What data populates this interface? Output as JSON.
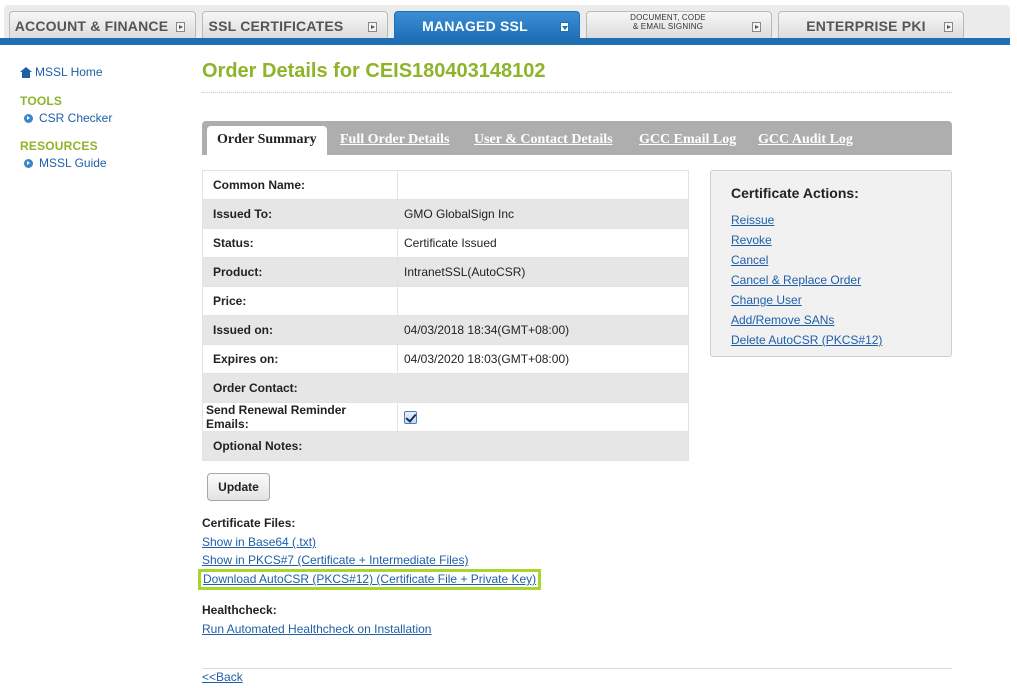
{
  "top_tabs": [
    {
      "label": "ACCOUNT & FINANCE"
    },
    {
      "label": "SSL CERTIFICATES"
    },
    {
      "label": "MANAGED SSL"
    },
    {
      "label_line1": "DOCUMENT, CODE",
      "label_line2": "& EMAIL SIGNING"
    },
    {
      "label": "ENTERPRISE PKI"
    }
  ],
  "sidebar": {
    "home": "MSSL Home",
    "tools_heading": "TOOLS",
    "tools": [
      "CSR Checker"
    ],
    "resources_heading": "RESOURCES",
    "resources": [
      "MSSL Guide"
    ]
  },
  "page_title": "Order Details for CEIS180403148102",
  "sub_tabs": [
    "Order Summary",
    "Full Order Details",
    "User & Contact Details",
    "GCC Email Log",
    "GCC Audit Log"
  ],
  "details": [
    {
      "label": "Common Name:",
      "value": ""
    },
    {
      "label": "Issued To:",
      "value": "GMO GlobalSign Inc"
    },
    {
      "label": "Status:",
      "value": "Certificate Issued"
    },
    {
      "label": "Product:",
      "value": "IntranetSSL(AutoCSR)"
    },
    {
      "label": "Price:",
      "value": ""
    },
    {
      "label": "Issued on:",
      "value": "04/03/2018 18:34(GMT+08:00)"
    },
    {
      "label": "Expires on:",
      "value": "04/03/2020 18:03(GMT+08:00)"
    },
    {
      "label": "Order Contact:",
      "value": ""
    },
    {
      "label": "Send Renewal Reminder Emails:",
      "checked": true
    },
    {
      "label": "Optional Notes:",
      "value": ""
    }
  ],
  "update_button": "Update",
  "actions": {
    "title": "Certificate Actions:",
    "links": [
      "Reissue",
      "Revoke",
      "Cancel",
      "Cancel & Replace Order",
      "Change User",
      "Add/Remove SANs",
      "Delete AutoCSR (PKCS#12)"
    ]
  },
  "certificate_files": {
    "heading": "Certificate Files:",
    "links": [
      "Show in Base64 (.txt)",
      "Show in PKCS#7 (Certificate + Intermediate Files)",
      "Download AutoCSR (PKCS#12) (Certificate File + Private Key)"
    ]
  },
  "healthcheck": {
    "heading": "Healthcheck:",
    "link": "Run Automated Healthcheck on Installation"
  },
  "back_link": "<<Back",
  "colors": {
    "brand_blue": "#1f6fb5",
    "heading_green": "#8db42a",
    "link_blue": "#1f5fa8",
    "highlight": "#a9d62d"
  }
}
